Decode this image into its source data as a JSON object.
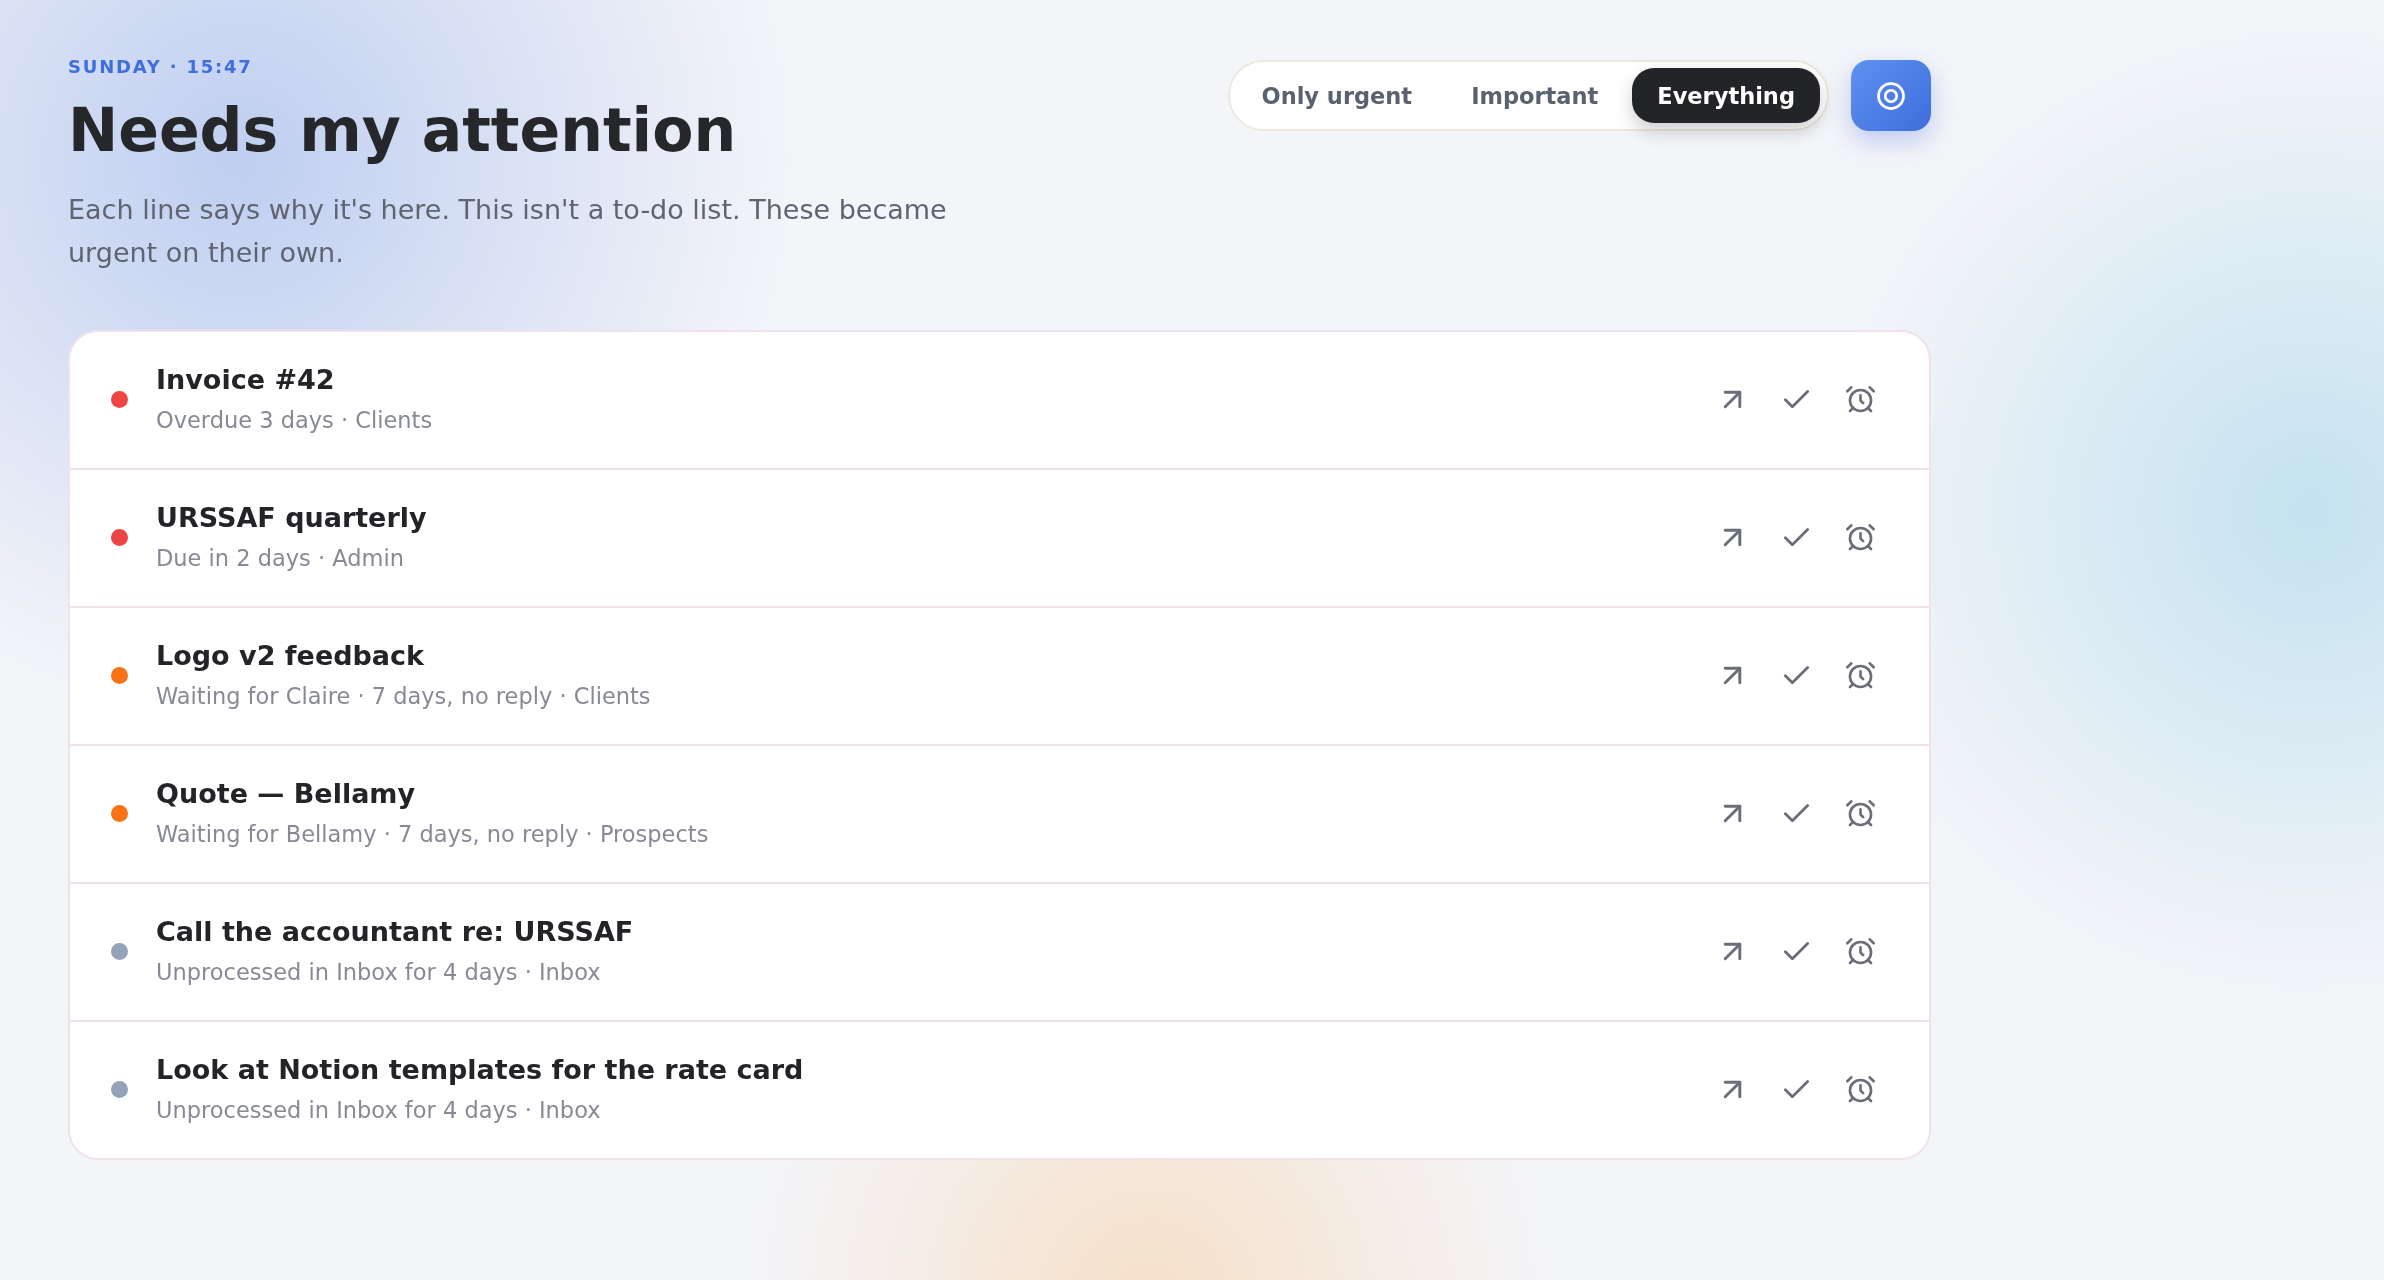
{
  "header": {
    "eyebrow": "SUNDAY · 15:47",
    "title": "Needs my attention",
    "subtitle": "Each line says why it's here. This isn't a to-do list. These became urgent on their own."
  },
  "filters": [
    {
      "label": "Only urgent",
      "selected": false
    },
    {
      "label": "Important",
      "selected": false
    },
    {
      "label": "Everything",
      "selected": true
    }
  ],
  "items": [
    {
      "title": "Invoice #42",
      "detail": "Overdue 3 days · Clients",
      "color": "#ef4444"
    },
    {
      "title": "URSSAF quarterly",
      "detail": "Due in 2 days · Admin",
      "color": "#ef4444"
    },
    {
      "title": "Logo v2 feedback",
      "detail": "Waiting for Claire · 7 days, no reply · Clients",
      "color": "#f97316"
    },
    {
      "title": "Quote — Bellamy",
      "detail": "Waiting for Bellamy · 7 days, no reply · Prospects",
      "color": "#f97316"
    },
    {
      "title": "Call the accountant re: URSSAF",
      "detail": "Unprocessed in Inbox for 4 days · Inbox",
      "color": "#94a3b8"
    },
    {
      "title": "Look at Notion templates for the rate card",
      "detail": "Unprocessed in Inbox for 4 days · Inbox",
      "color": "#94a3b8"
    }
  ]
}
